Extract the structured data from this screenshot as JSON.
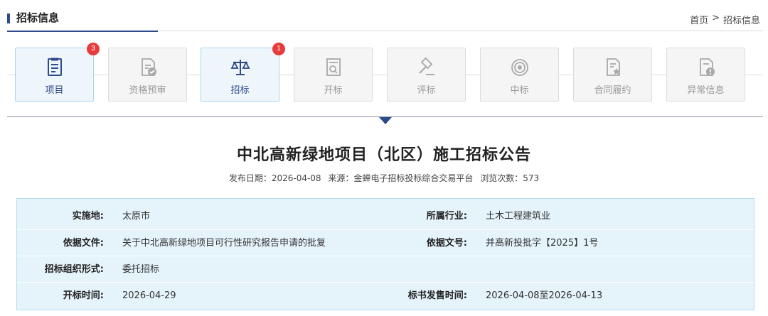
{
  "header": {
    "title": "招标信息"
  },
  "breadcrumb": {
    "home": "首页",
    "separator": ">",
    "current": "招标信息"
  },
  "steps": [
    {
      "label": "项目",
      "state": "active",
      "badge": "3",
      "icon": "document-list-icon"
    },
    {
      "label": "资格预审",
      "state": "disabled",
      "badge": "",
      "icon": "document-check-icon"
    },
    {
      "label": "招标",
      "state": "active",
      "badge": "1",
      "icon": "scale-icon"
    },
    {
      "label": "开标",
      "state": "disabled",
      "badge": "",
      "icon": "document-search-icon"
    },
    {
      "label": "评标",
      "state": "disabled",
      "badge": "",
      "icon": "gavel-icon"
    },
    {
      "label": "中标",
      "state": "disabled",
      "badge": "",
      "icon": "target-icon"
    },
    {
      "label": "合同履约",
      "state": "disabled",
      "badge": "",
      "icon": "document-star-icon"
    },
    {
      "label": "异常信息",
      "state": "disabled",
      "badge": "",
      "icon": "document-warning-icon"
    }
  ],
  "notice": {
    "title": "中北高新绿地项目（北区）施工招标公告",
    "publish_date_label": "发布日期：",
    "publish_date": "2026-04-08",
    "source_label": "来源：",
    "source": "金蝉电子招标投标综合交易平台",
    "views_label": "浏览次数：",
    "views": "573"
  },
  "info": {
    "rows": [
      {
        "label1": "实施地:",
        "value1": "太原市",
        "label2": "所属行业:",
        "value2": "土木工程建筑业"
      },
      {
        "label1": "依据文件:",
        "value1": "关于中北高新绿地项目可行性研究报告申请的批复",
        "label2": "依据文号:",
        "value2": "并高新投批字【2025】1号"
      },
      {
        "label1": "招标组织形式:",
        "value1": "委托招标",
        "label2": "",
        "value2": ""
      },
      {
        "label1": "开标时间:",
        "value1": "2026-04-29",
        "label2": "标书发售时间:",
        "value2": "2026-04-08至2026-04-13"
      }
    ]
  },
  "colors": {
    "accent": "#2d4a8a",
    "badge": "#e63c3c",
    "active_step_bg": "#eef6fc",
    "info_bg": "#e5f3fb"
  }
}
